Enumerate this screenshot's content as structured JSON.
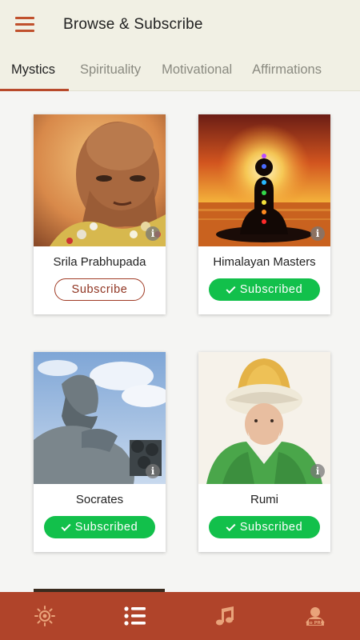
{
  "header": {
    "title": "Browse & Subscribe"
  },
  "tabs": [
    {
      "label": "Mystics",
      "active": true
    },
    {
      "label": "Spirituality",
      "active": false
    },
    {
      "label": "Motivational",
      "active": false
    },
    {
      "label": "Affirmations",
      "active": false
    }
  ],
  "cards": [
    {
      "name": "Srila Prabhupada",
      "status": "Subscribe",
      "subscribed": false
    },
    {
      "name": "Himalayan Masters",
      "status": "Subscribed",
      "subscribed": true
    },
    {
      "name": "Socrates",
      "status": "Subscribed",
      "subscribed": true
    },
    {
      "name": "Rumi",
      "status": "Subscribed",
      "subscribed": true
    }
  ],
  "info_glyph": "i",
  "bottom_nav": [
    {
      "icon": "sun-icon"
    },
    {
      "icon": "list-icon",
      "active": true
    },
    {
      "icon": "music-note-icon"
    },
    {
      "icon": "go-pro-icon",
      "label": "Go PRO"
    }
  ],
  "colors": {
    "accent": "#b0442a",
    "subscribed_green": "#12c04b",
    "header_bg": "#f1f0e4"
  }
}
